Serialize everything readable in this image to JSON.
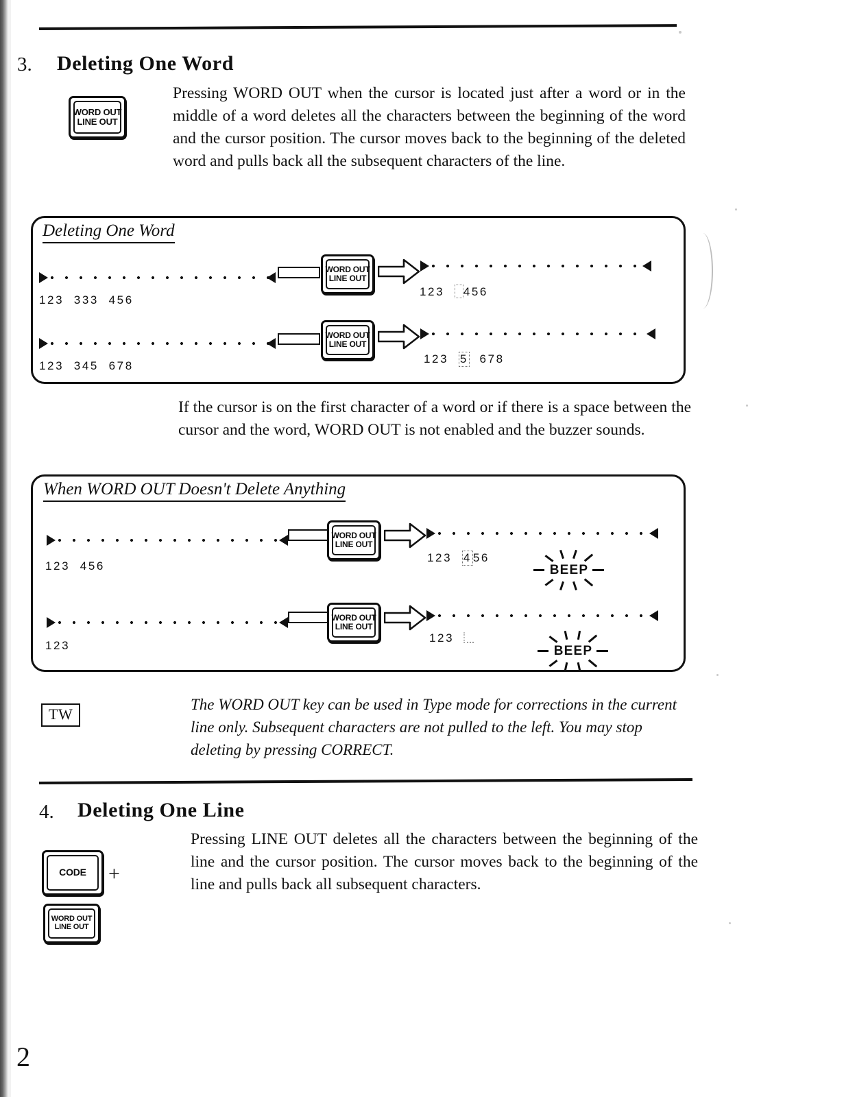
{
  "document": {
    "page_number": "2",
    "sections": [
      {
        "number": "3.",
        "title": "Deleting One Word",
        "key_icon": {
          "line1": "WORD OUT",
          "line2": "LINE OUT"
        },
        "body": "Pressing WORD OUT when the cursor is located just after a word or in the middle of a word deletes all the characters between the beginning of the word and the cursor position. The cursor moves back to the beginning of the deleted word and pulls back all the subsequent characters of the line."
      },
      {
        "number": "4.",
        "title": "Deleting One Line",
        "key_icon_1": {
          "line1": "CODE"
        },
        "key_icon_2": {
          "line1": "WORD OUT",
          "line2": "LINE OUT"
        },
        "plus": "+",
        "body": "Pressing LINE OUT deletes all the characters between the beginning of the line and the cursor position. The cursor moves back to the beginning of the line and pulls back all subsequent characters."
      }
    ],
    "middle_note": "If the cursor is on the first character of a word or if there is a space between the cursor and the word, WORD OUT is not enabled and the buzzer sounds.",
    "tw_note": {
      "badge": "TW",
      "text": "The WORD OUT key can be used in Type mode for corrections in the current line only. Subsequent characters are not pulled to the left. You may stop deleting by pressing CORRECT."
    },
    "diagrams": [
      {
        "title": "Deleting One Word",
        "rows": [
          {
            "before_digits": "123  333  456",
            "key": {
              "line1": "WORD OUT",
              "line2": "LINE OUT"
            },
            "after_digits_pre": "123  ",
            "after_digits_post": "456",
            "beep": null
          },
          {
            "before_digits": "123  345  678",
            "key": {
              "line1": "WORD OUT",
              "line2": "LINE OUT"
            },
            "after_digits_pre": "123  ",
            "after_cursor_char": "5",
            "after_digits_post": "  678",
            "beep": null
          }
        ]
      },
      {
        "title": "When WORD OUT Doesn't Delete Anything",
        "rows": [
          {
            "before_digits": "123  456",
            "key": {
              "line1": "WORD OUT",
              "line2": "LINE OUT"
            },
            "after_digits_pre": "123  ",
            "after_cursor_char": "4",
            "after_digits_post": "56",
            "beep": "BEEP"
          },
          {
            "before_digits": "123",
            "key": {
              "line1": "WORD OUT",
              "line2": "LINE OUT"
            },
            "after_digits_pre": "123",
            "after_digits_post": "",
            "beep": "BEEP"
          }
        ]
      }
    ]
  },
  "colors": {
    "ink": "#111111",
    "paper": "#ffffff",
    "faint": "#9a9a9a"
  }
}
